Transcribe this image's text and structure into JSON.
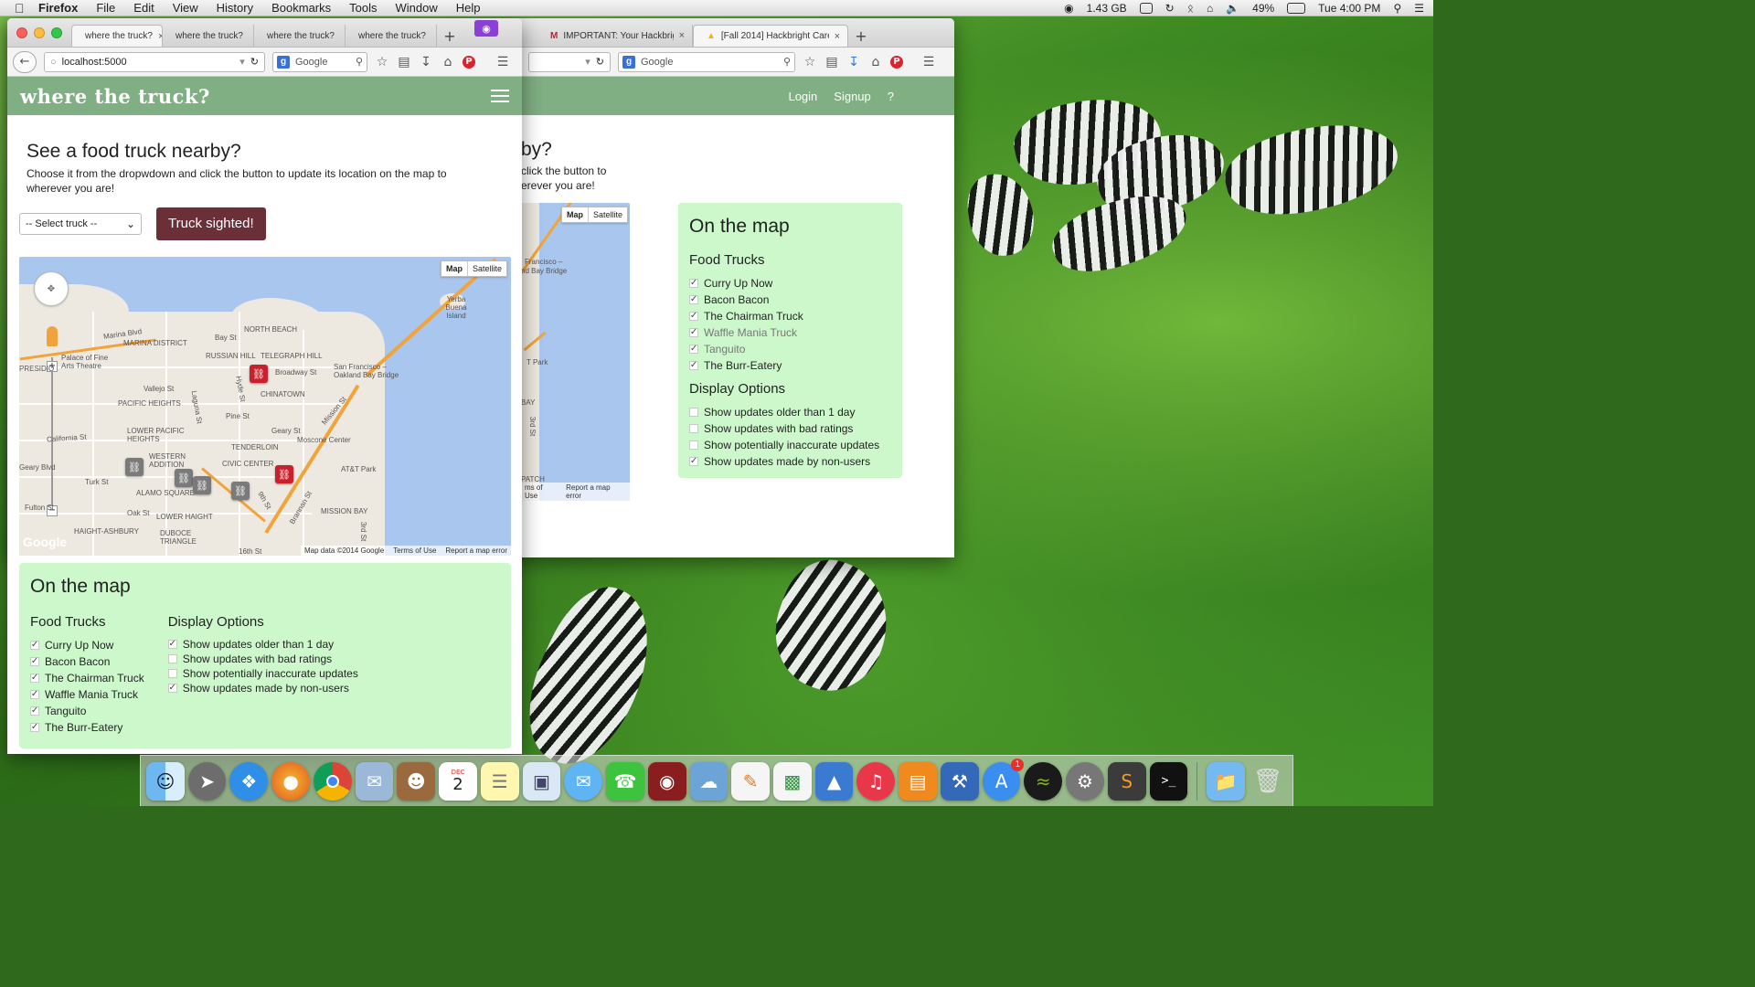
{
  "menubar": {
    "app": "Firefox",
    "items": [
      "File",
      "Edit",
      "View",
      "History",
      "Bookmarks",
      "Tools",
      "Window",
      "Help"
    ],
    "memory": "1.43 GB",
    "battery": "49%",
    "clock": "Tue 4:00 PM"
  },
  "front_window": {
    "tabs": [
      {
        "label": "where the truck?",
        "close": "×"
      },
      {
        "label": "where the truck?",
        "close": ""
      },
      {
        "label": "where the truck?",
        "close": ""
      },
      {
        "label": "where the truck?",
        "close": ""
      }
    ],
    "new_tab": "+",
    "url": "localhost:5000",
    "search_placeholder": "Google",
    "brand": "where the truck?",
    "heading": "See a food truck nearby?",
    "subtext": "Choose it from the dropwdown and click the button to update its location on the map to wherever you are!",
    "select_value": "-- Select truck --",
    "sighted_button": "Truck sighted!",
    "map": {
      "btn_map": "Map",
      "btn_satellite": "Satellite",
      "labels": [
        "Marina Blvd",
        "MARINA DISTRICT",
        "NORTH BEACH",
        "Bay St",
        "RUSSIAN HILL",
        "TELEGRAPH HILL",
        "Yerba Buena Island",
        "Palace of Fine Arts Theatre",
        "PRESIDIO",
        "Broadway St",
        "San Francisco – Oakland Bay Bridge",
        "Vallejo St",
        "PACIFIC HEIGHTS",
        "CHINATOWN",
        "Pine St",
        "Hyde St",
        "Laguna St",
        "LOWER PACIFIC HEIGHTS",
        "California St",
        "Geary St",
        "Moscone Center",
        "TENDERLOIN",
        "Geary Blvd",
        "WESTERN ADDITION",
        "CIVIC CENTER",
        "AT&T Park",
        "Turk St",
        "ALAMO SQUARE",
        "Fulton St",
        "Oak St",
        "LOWER HAIGHT",
        "MISSION BAY",
        "HAIGHT-ASHBURY",
        "DUBOCE TRIANGLE",
        "16th St",
        "9th St",
        "Brannan St",
        "Mission St",
        "3rd St",
        "Google"
      ],
      "footer": [
        "Map data ©2014 Google",
        "Terms of Use",
        "Report a map error"
      ]
    },
    "on_the_map": {
      "title": "On the map",
      "trucks_title": "Food Trucks",
      "trucks": [
        {
          "label": "Curry Up Now",
          "checked": true
        },
        {
          "label": "Bacon Bacon",
          "checked": true
        },
        {
          "label": "The Chairman Truck",
          "checked": true
        },
        {
          "label": "Waffle Mania Truck",
          "checked": true
        },
        {
          "label": "Tanguito",
          "checked": true
        },
        {
          "label": "The Burr-Eatery",
          "checked": true
        }
      ],
      "options_title": "Display Options",
      "options": [
        {
          "label": "Show updates older than 1 day",
          "checked": true
        },
        {
          "label": "Show updates with bad ratings",
          "checked": false
        },
        {
          "label": "Show potentially inaccurate updates",
          "checked": false
        },
        {
          "label": "Show updates made by non-users",
          "checked": true
        }
      ]
    }
  },
  "back_window": {
    "tabs": [
      {
        "label": "IMPORTANT: Your Hackbrig...",
        "close": "×"
      },
      {
        "label": "[Fall 2014] Hackbright Caree...",
        "close": "×"
      }
    ],
    "new_tab": "+",
    "search_placeholder": "Google",
    "nav": [
      "Login",
      "Signup",
      "?"
    ],
    "heading_fragment": "by?",
    "subtext_line1": "click the button to",
    "subtext_line2": "erever you are!",
    "map_btn_map": "Map",
    "map_btn_satellite": "Satellite",
    "map_labels": [
      "Francisco –",
      "nd Bay Bridge",
      "T Park",
      "BAY",
      "3rd St",
      "PATCH"
    ],
    "map_footer": [
      "ms of Use",
      "Report a map error"
    ],
    "on_the_map": {
      "title": "On the map",
      "trucks_title": "Food Trucks",
      "trucks": [
        "Curry Up Now",
        "Bacon Bacon",
        "The Chairman Truck",
        "Waffle Mania Truck",
        "Tanguito",
        "The Burr-Eatery"
      ],
      "options_title": "Display Options",
      "options": [
        "Show updates older than 1 day",
        "Show updates with bad ratings",
        "Show potentially inaccurate updates",
        "Show updates made by non-users"
      ]
    }
  },
  "dock": {
    "calendar_day": "2",
    "calendar_month": "DEC",
    "appstore_badge": "1"
  },
  "colors": {
    "header_green": "#7faf82",
    "panel_green": "#ccf8cc",
    "button_maroon": "#6b2f38",
    "marker_red": "#c8202c"
  }
}
